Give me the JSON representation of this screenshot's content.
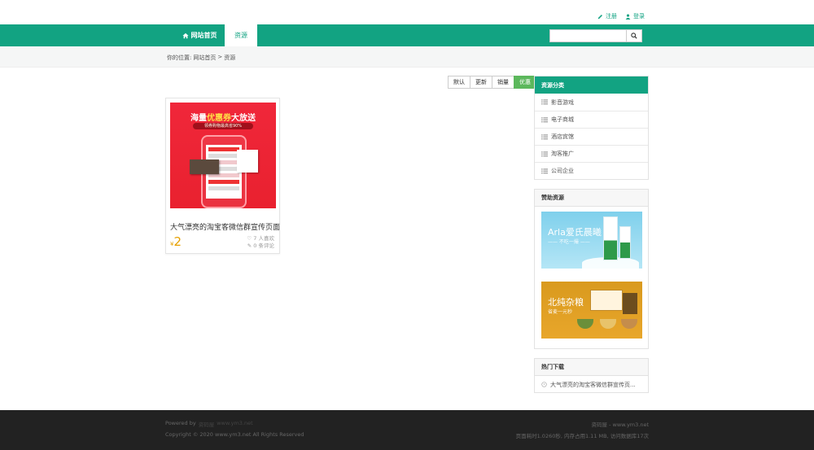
{
  "top_links": {
    "register": "注册",
    "login": "登录"
  },
  "nav": {
    "home": "网站首页",
    "active": "资源"
  },
  "search": {
    "placeholder": ""
  },
  "breadcrumb": {
    "prefix": "你的位置:",
    "home": "网站首页",
    "sep": ">",
    "current": "资源"
  },
  "sort": [
    "默认",
    "更新",
    "销量",
    "优惠"
  ],
  "sort_active": "优惠",
  "product": {
    "banner_title_a": "海量",
    "banner_title_b": "优惠券",
    "banner_title_c": "大放送",
    "banner_subtitle": "领券购物最高省90%",
    "title": "大气漂亮的淘宝客微信群宣传页面",
    "currency": "¥",
    "price": "2",
    "likes": "7 人喜欢",
    "comments": "0 条评论"
  },
  "categories": {
    "title": "资源分类",
    "items": [
      "影音游戏",
      "电子商城",
      "酒店宾馆",
      "淘客推广",
      "公司企业"
    ]
  },
  "sponsor": {
    "title": "赞助资源",
    "ad1_title": "Arla爱氏晨曦",
    "ad1_sub": "—— 不吃一撮 ——",
    "ad2_title": "北纯杂粮",
    "ad2_sub": "省麦一元秒"
  },
  "hot": {
    "title": "热门下载",
    "items": [
      "大气漂亮的淘宝客微信群宣传页..."
    ]
  },
  "footer": {
    "powered_by": "Powered by",
    "powered_link": "资码屋",
    "powered_domain": "www.ym3.net",
    "copyright": "Copyright © 2020 www.ym3.net All Rights Reserved",
    "site": "资码屋 - www.ym3.net",
    "stats": "页面耗时1.0260秒, 内存占用1.11 MB, 访问数据库17次"
  },
  "colors": {
    "brand": "#12a382",
    "active_sort": "#5cb85c",
    "price": "#e6a000",
    "footer_bg": "#222222"
  }
}
